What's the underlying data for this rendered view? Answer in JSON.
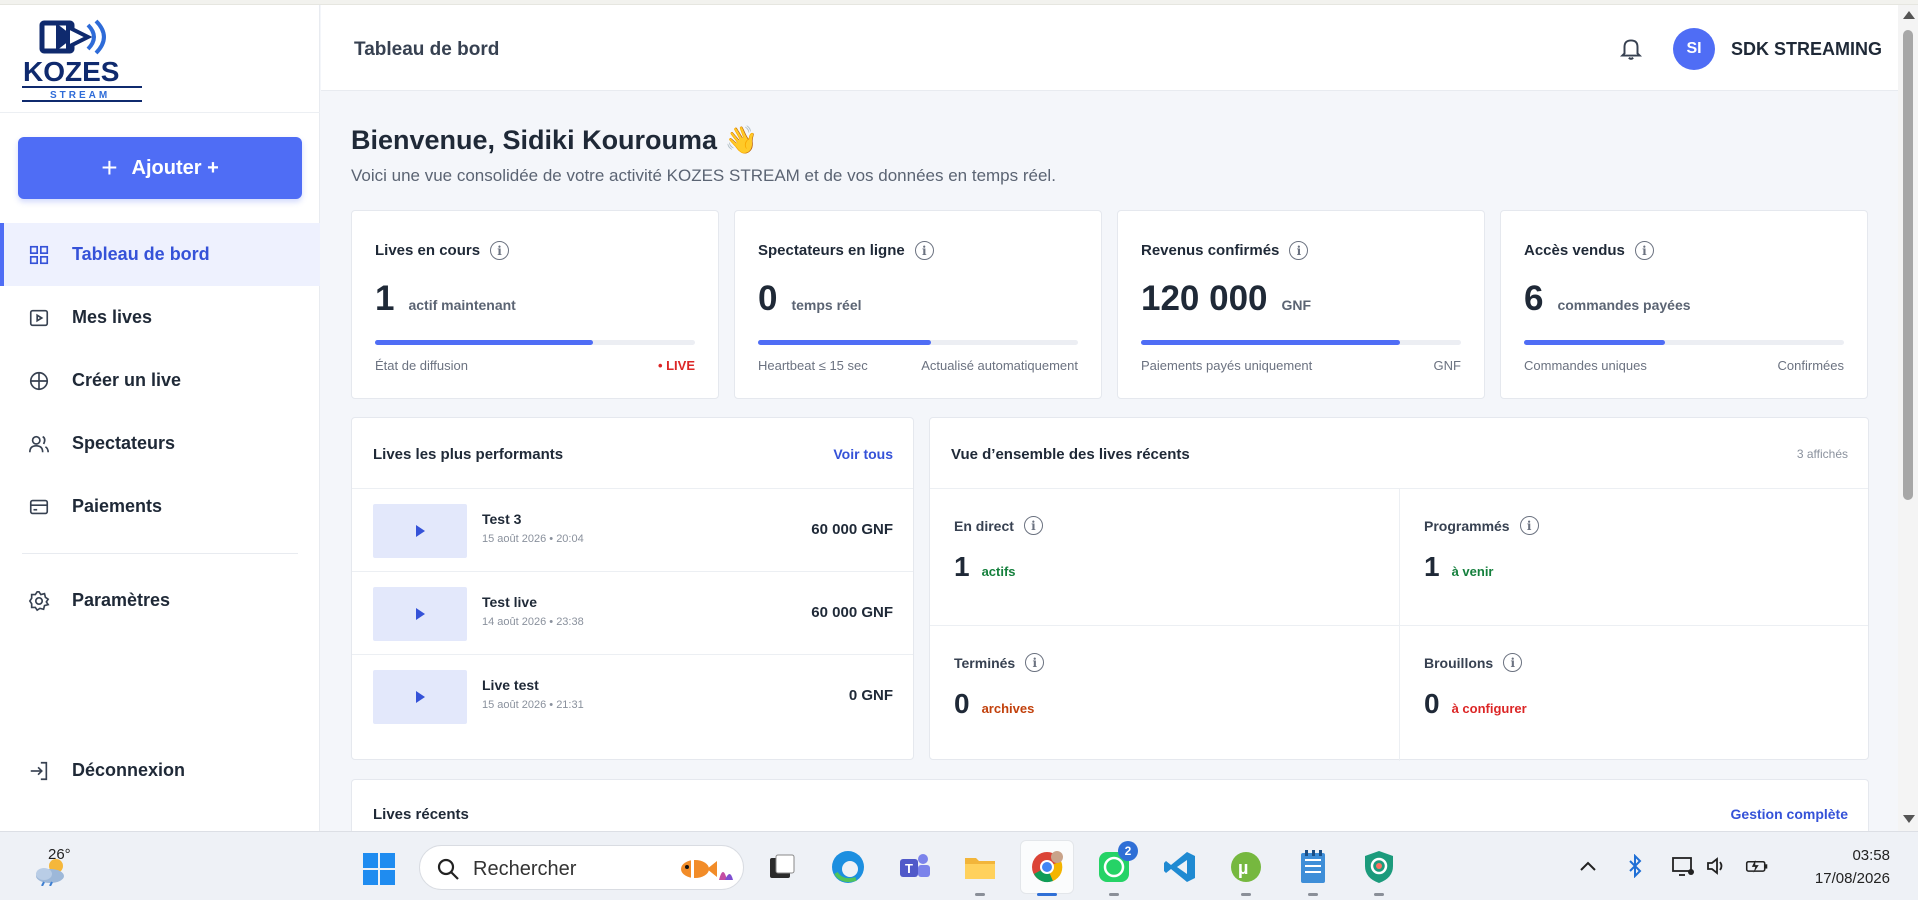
{
  "brand": {
    "name": "KOZES",
    "tagline": "STREAM",
    "color": "#0f2a6e",
    "accent": "#4f6df5"
  },
  "sidebar": {
    "add_button": "Ajouter +",
    "items": [
      {
        "label": "Tableau de bord",
        "icon": "grid-icon",
        "active": true
      },
      {
        "label": "Mes lives",
        "icon": "video-icon"
      },
      {
        "label": "Créer un live",
        "icon": "plus-circle-icon"
      },
      {
        "label": "Spectateurs",
        "icon": "users-icon"
      },
      {
        "label": "Paiements",
        "icon": "card-icon"
      }
    ],
    "settings": "Paramètres",
    "logout": "Déconnexion"
  },
  "header": {
    "title": "Tableau de bord",
    "avatar_initials": "SI",
    "user_name": "SDK STREAMING"
  },
  "welcome": {
    "title": "Bienvenue, Sidiki Kourouma 👋",
    "subtitle": "Voici une vue consolidée de votre activité KOZES STREAM et de vos données en temps réel."
  },
  "stats": [
    {
      "title": "Lives en cours",
      "value": "1",
      "unit": "actif maintenant",
      "progress": 0.68,
      "foot_left": "État de diffusion",
      "foot_right": "• LIVE"
    },
    {
      "title": "Spectateurs en ligne",
      "value": "0",
      "unit": "temps réel",
      "progress": 0.54,
      "foot_left": "Heartbeat ≤ 15 sec",
      "foot_right": "Actualisé automatiquement"
    },
    {
      "title": "Revenus confirmés",
      "value": "120 000",
      "unit": "GNF",
      "progress": 0.81,
      "foot_left": "Paiements payés uniquement",
      "foot_right": "GNF"
    },
    {
      "title": "Accès vendus",
      "value": "6",
      "unit": "commandes payées",
      "progress": 0.44,
      "foot_left": "Commandes uniques",
      "foot_right": "Confirmées"
    }
  ],
  "top_lives": {
    "title": "Lives les plus performants",
    "link": "Voir tous",
    "rows": [
      {
        "name": "Test 3",
        "date": "15 août 2026 • 20:04",
        "amount": "60 000 GNF"
      },
      {
        "name": "Test live",
        "date": "14 août 2026 • 23:38",
        "amount": "60 000 GNF"
      },
      {
        "name": "Live test",
        "date": "15 août 2026 • 21:31",
        "amount": "0 GNF"
      }
    ]
  },
  "overview": {
    "title": "Vue d’ensemble des lives récents",
    "count": "3 affichés",
    "cells": [
      {
        "title": "En direct",
        "value": "1",
        "label": "actifs",
        "color": "#15803d"
      },
      {
        "title": "Programmés",
        "value": "1",
        "label": "à venir",
        "color": "#15803d"
      },
      {
        "title": "Terminés",
        "value": "0",
        "label": "archives",
        "color": "#c2410c"
      },
      {
        "title": "Brouillons",
        "value": "0",
        "label": "à configurer",
        "color": "#dc2626"
      }
    ]
  },
  "recent": {
    "title": "Lives récents",
    "link": "Gestion complète"
  },
  "taskbar": {
    "weather_temp": "26°",
    "search_placeholder": "Rechercher",
    "whatsapp_badge": "2",
    "time": "03:58",
    "date": "17/08/2026"
  }
}
